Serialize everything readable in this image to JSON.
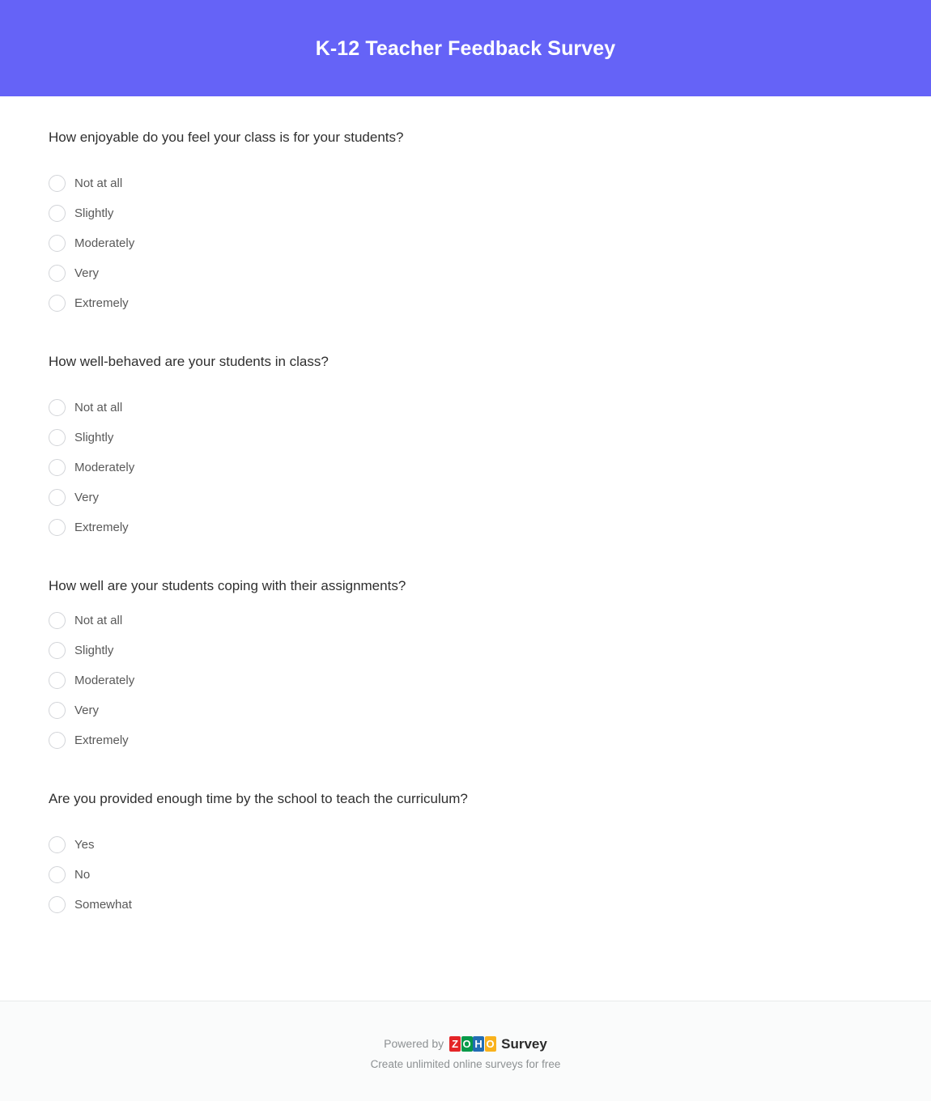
{
  "header": {
    "title": "K-12 Teacher Feedback Survey",
    "background_color": "#6563f7",
    "title_color": "#ffffff"
  },
  "questions": [
    {
      "text": "How enjoyable do you feel your class is for your students?",
      "options": [
        "Not at all",
        "Slightly",
        "Moderately",
        "Very",
        "Extremely"
      ]
    },
    {
      "text": "How well-behaved are your students in class?",
      "options": [
        "Not at all",
        "Slightly",
        "Moderately",
        "Very",
        "Extremely"
      ]
    },
    {
      "text": "How well are your students coping with their assignments?",
      "options": [
        "Not at all",
        "Slightly",
        "Moderately",
        "Very",
        "Extremely"
      ]
    },
    {
      "text": "Are you provided enough time by the school to teach the curriculum?",
      "options": [
        "Yes",
        "No",
        "Somewhat"
      ]
    }
  ],
  "footer": {
    "powered_by": "Powered by",
    "brand_letters": [
      {
        "char": "Z",
        "color": "#e42527"
      },
      {
        "char": "O",
        "color": "#089949"
      },
      {
        "char": "H",
        "color": "#226db4"
      },
      {
        "char": "O",
        "color": "#f9b21d"
      }
    ],
    "brand_product": "Survey",
    "tagline": "Create unlimited online surveys for free",
    "background_color": "#fafbfb",
    "text_color": "#8d9193"
  }
}
